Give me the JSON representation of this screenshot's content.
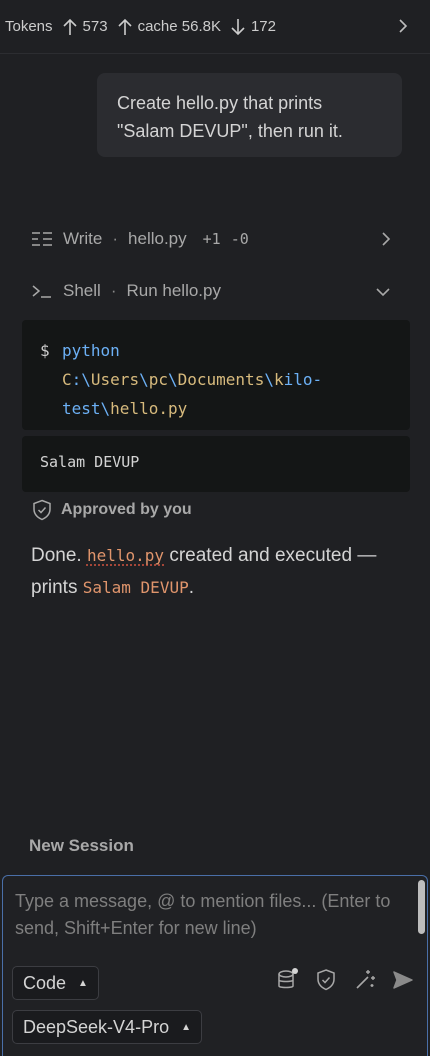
{
  "token_bar": {
    "label": "Tokens",
    "up": "573",
    "cache": "cache 56.8K",
    "down": "172"
  },
  "user_message": "Create hello.py that prints \"Salam DEVUP\", then run it.",
  "tools": {
    "write": {
      "name": "Write",
      "file": "hello.py",
      "added": "+1",
      "removed": "-0"
    },
    "shell": {
      "name": "Shell",
      "description": "Run hello.py"
    }
  },
  "command": {
    "prompt": "$",
    "program": "python",
    "path_parts": [
      "C",
      ":\\",
      "Users",
      "\\",
      "pc",
      "\\",
      "Documents",
      "\\",
      "k",
      "ilo-",
      "test",
      "\\",
      "hello.py"
    ]
  },
  "output": "Salam DEVUP",
  "approval": "Approved by you",
  "assistant_message": {
    "prefix": "Done. ",
    "file": "hello.py",
    "middle": " created and executed — prints ",
    "value": "Salam DEVUP",
    "suffix": "."
  },
  "new_session_label": "New Session",
  "composer": {
    "placeholder": "Type a message, @ to mention files... (Enter to send, Shift+Enter for new line)",
    "mode": "Code",
    "model": "DeepSeek-V4-Pro"
  },
  "icons": {
    "write": "list-edit-icon",
    "shell": "terminal-icon",
    "approved": "shield-check-icon",
    "database": "database-icon",
    "shield": "shield-icon",
    "magic": "magic-wand-icon",
    "send": "send-icon"
  },
  "colors": {
    "background": "#1f2023",
    "code_blue": "#6cb0f5",
    "path_yellow": "#d7ba7d",
    "inline_code": "#e0956c",
    "focus_border": "#4a6fa8"
  }
}
